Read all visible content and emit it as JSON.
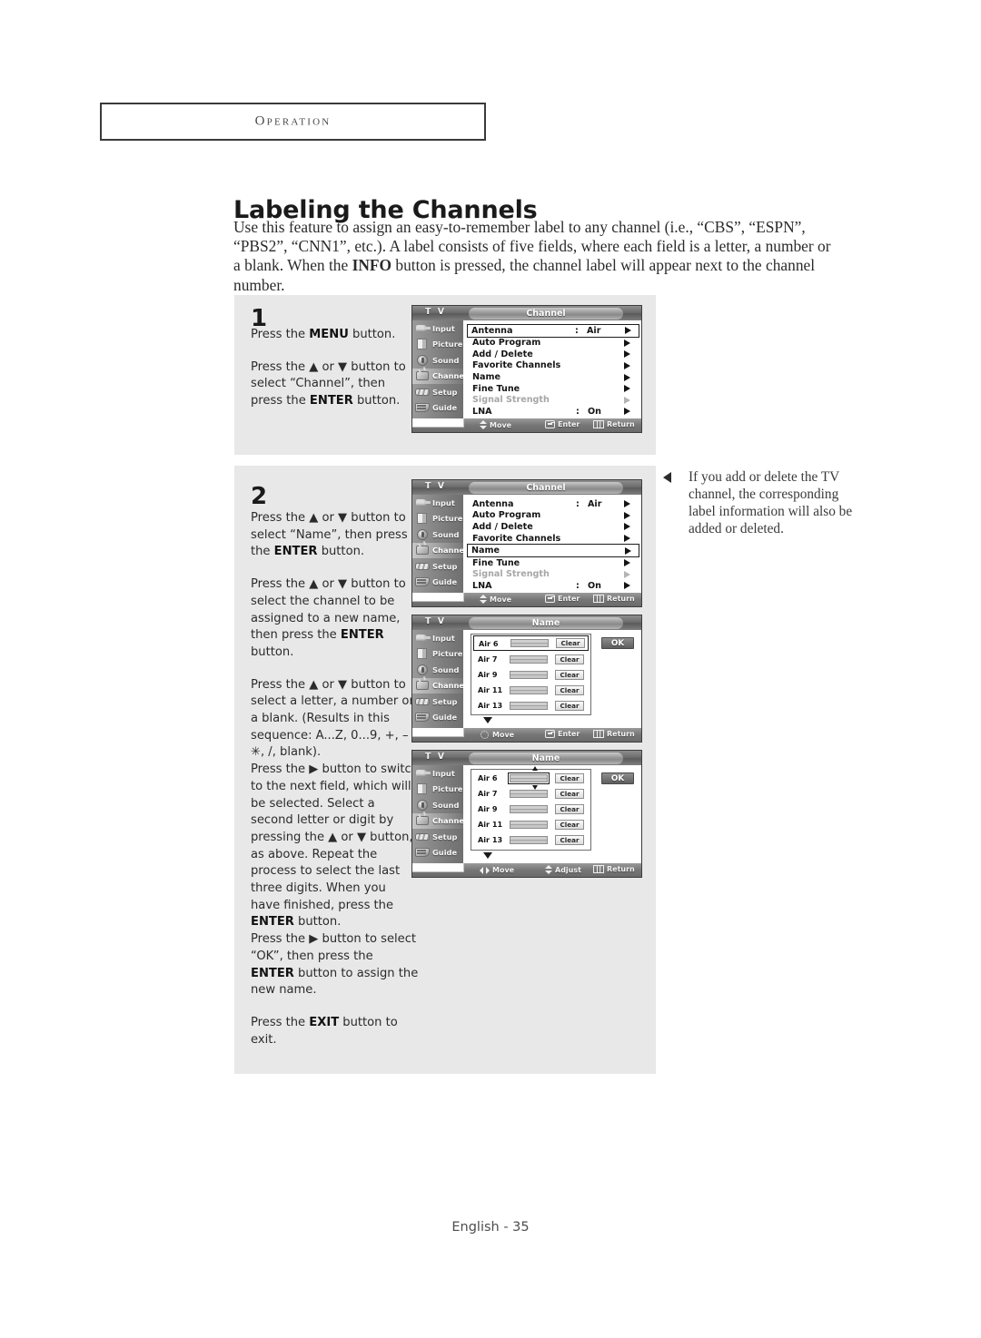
{
  "header": {
    "chapter": "Operation"
  },
  "page": {
    "title": "Labeling the Channels",
    "intro_html": "Use this feature to assign an easy-to-remember label to any channel (i.e., “CBS”, “ESPN”, “PBS2”, “CNN1”, etc.). A label consists of five fields, where each field is a letter, a number or a blank. When the <b>INFO</b> button is pressed, the channel label will appear next to the channel number.",
    "footer": "English - 35"
  },
  "steps": [
    {
      "number": "1",
      "text_html": "<p>Press the <b>MENU</b> button.</p><p>Press the ▲ or ▼ button to select “Channel”, then press the <b>ENTER</b> button.</p>"
    },
    {
      "number": "2",
      "text_html": "<p>Press the ▲ or ▼ button to select “Name”, then press the <b>ENTER</b> button.</p><p>Press the ▲ or ▼ button to select the channel to be assigned to a new name, then press the <b>ENTER</b> button.</p><p>Press the ▲ or ▼ button to select a letter, a number or a blank. (Results in this sequence: A...Z, 0...9, +, – , ✳, /, blank).<br>Press the ▶ button to switch to the next field, which will be selected. Select a second letter or digit by pressing the ▲ or ▼ button, as above. Repeat the process to select the last three digits. When you have finished, press the <b>ENTER</b> button.<br>Press the ▶ button to select “OK”, then press the <b>ENTER</b> button to assign the new name.</p><p>Press the <b>EXIT</b> button to exit.</p>"
    }
  ],
  "side_note": {
    "marker": "left-triangle-icon",
    "text": "If you add or delete the TV channel, the corresponding label information will also be added or deleted."
  },
  "tv_rail": [
    {
      "label": "Input",
      "icon": "input-icon"
    },
    {
      "label": "Picture",
      "icon": "picture-icon"
    },
    {
      "label": "Sound",
      "icon": "sound-icon"
    },
    {
      "label": "Channel",
      "icon": "channel-icon"
    },
    {
      "label": "Setup",
      "icon": "setup-icon"
    },
    {
      "label": "Guide",
      "icon": "guide-icon"
    }
  ],
  "screens": {
    "channel_menu": {
      "brand": "T V",
      "title": "Channel",
      "active_rail": "Channel",
      "rows": [
        {
          "label": "Antenna",
          "colon": ":",
          "value": "Air",
          "dim": false
        },
        {
          "label": "Auto Program",
          "colon": "",
          "value": "",
          "dim": false
        },
        {
          "label": "Add / Delete",
          "colon": "",
          "value": "",
          "dim": false
        },
        {
          "label": "Favorite Channels",
          "colon": "",
          "value": "",
          "dim": false
        },
        {
          "label": "Name",
          "colon": "",
          "value": "",
          "dim": false
        },
        {
          "label": "Fine Tune",
          "colon": "",
          "value": "",
          "dim": false
        },
        {
          "label": "Signal Strength",
          "colon": "",
          "value": "",
          "dim": true
        },
        {
          "label": "LNA",
          "colon": ":",
          "value": "On",
          "dim": false
        }
      ],
      "hints": [
        {
          "glyph": "updown-icon",
          "label": "Move"
        },
        {
          "glyph": "enter-icon",
          "label": "Enter"
        },
        {
          "glyph": "return-icon",
          "label": "Return"
        }
      ]
    },
    "name_menu": {
      "brand": "T V",
      "title": "Name",
      "active_rail": "Channel",
      "ok_label": "OK",
      "clear_label": "Clear",
      "channels": [
        "Air 6",
        "Air 7",
        "Air 9",
        "Air 11",
        "Air 13"
      ],
      "hints_step3": [
        {
          "glyph": "fourway-icon",
          "label": "Move"
        },
        {
          "glyph": "enter-icon",
          "label": "Enter"
        },
        {
          "glyph": "return-icon",
          "label": "Return"
        }
      ],
      "hints_step4": [
        {
          "glyph": "leftright-icon",
          "label": "Move"
        },
        {
          "glyph": "updown-icon",
          "label": "Adjust"
        },
        {
          "glyph": "return-icon",
          "label": "Return"
        }
      ]
    }
  },
  "selection": {
    "screen1_selected_row": "Antenna",
    "screen2_selected_row": "Name",
    "screen3_selected_channel": "Air 6",
    "screen4_selected_field": "Air 6"
  },
  "colors": {
    "panel_bg": "#e8e8e8",
    "text": "#2b2b2b",
    "osd_rail": "#808080",
    "osd_dim_text": "#a6a6a6"
  }
}
